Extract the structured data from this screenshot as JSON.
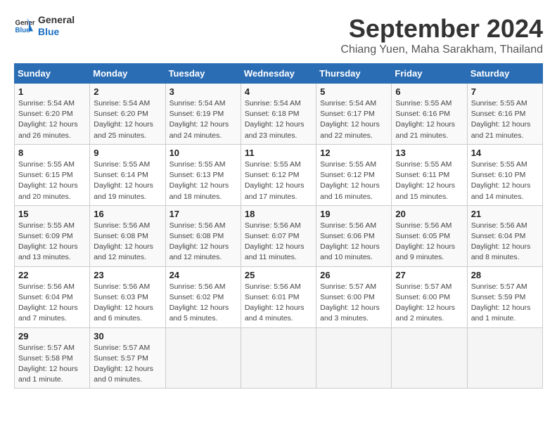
{
  "header": {
    "logo_line1": "General",
    "logo_line2": "Blue",
    "title": "September 2024",
    "subtitle": "Chiang Yuen, Maha Sarakham, Thailand"
  },
  "weekdays": [
    "Sunday",
    "Monday",
    "Tuesday",
    "Wednesday",
    "Thursday",
    "Friday",
    "Saturday"
  ],
  "weeks": [
    [
      {
        "day": "1",
        "detail": "Sunrise: 5:54 AM\nSunset: 6:20 PM\nDaylight: 12 hours\nand 26 minutes."
      },
      {
        "day": "2",
        "detail": "Sunrise: 5:54 AM\nSunset: 6:20 PM\nDaylight: 12 hours\nand 25 minutes."
      },
      {
        "day": "3",
        "detail": "Sunrise: 5:54 AM\nSunset: 6:19 PM\nDaylight: 12 hours\nand 24 minutes."
      },
      {
        "day": "4",
        "detail": "Sunrise: 5:54 AM\nSunset: 6:18 PM\nDaylight: 12 hours\nand 23 minutes."
      },
      {
        "day": "5",
        "detail": "Sunrise: 5:54 AM\nSunset: 6:17 PM\nDaylight: 12 hours\nand 22 minutes."
      },
      {
        "day": "6",
        "detail": "Sunrise: 5:55 AM\nSunset: 6:16 PM\nDaylight: 12 hours\nand 21 minutes."
      },
      {
        "day": "7",
        "detail": "Sunrise: 5:55 AM\nSunset: 6:16 PM\nDaylight: 12 hours\nand 21 minutes."
      }
    ],
    [
      {
        "day": "8",
        "detail": "Sunrise: 5:55 AM\nSunset: 6:15 PM\nDaylight: 12 hours\nand 20 minutes."
      },
      {
        "day": "9",
        "detail": "Sunrise: 5:55 AM\nSunset: 6:14 PM\nDaylight: 12 hours\nand 19 minutes."
      },
      {
        "day": "10",
        "detail": "Sunrise: 5:55 AM\nSunset: 6:13 PM\nDaylight: 12 hours\nand 18 minutes."
      },
      {
        "day": "11",
        "detail": "Sunrise: 5:55 AM\nSunset: 6:12 PM\nDaylight: 12 hours\nand 17 minutes."
      },
      {
        "day": "12",
        "detail": "Sunrise: 5:55 AM\nSunset: 6:12 PM\nDaylight: 12 hours\nand 16 minutes."
      },
      {
        "day": "13",
        "detail": "Sunrise: 5:55 AM\nSunset: 6:11 PM\nDaylight: 12 hours\nand 15 minutes."
      },
      {
        "day": "14",
        "detail": "Sunrise: 5:55 AM\nSunset: 6:10 PM\nDaylight: 12 hours\nand 14 minutes."
      }
    ],
    [
      {
        "day": "15",
        "detail": "Sunrise: 5:55 AM\nSunset: 6:09 PM\nDaylight: 12 hours\nand 13 minutes."
      },
      {
        "day": "16",
        "detail": "Sunrise: 5:56 AM\nSunset: 6:08 PM\nDaylight: 12 hours\nand 12 minutes."
      },
      {
        "day": "17",
        "detail": "Sunrise: 5:56 AM\nSunset: 6:08 PM\nDaylight: 12 hours\nand 12 minutes."
      },
      {
        "day": "18",
        "detail": "Sunrise: 5:56 AM\nSunset: 6:07 PM\nDaylight: 12 hours\nand 11 minutes."
      },
      {
        "day": "19",
        "detail": "Sunrise: 5:56 AM\nSunset: 6:06 PM\nDaylight: 12 hours\nand 10 minutes."
      },
      {
        "day": "20",
        "detail": "Sunrise: 5:56 AM\nSunset: 6:05 PM\nDaylight: 12 hours\nand 9 minutes."
      },
      {
        "day": "21",
        "detail": "Sunrise: 5:56 AM\nSunset: 6:04 PM\nDaylight: 12 hours\nand 8 minutes."
      }
    ],
    [
      {
        "day": "22",
        "detail": "Sunrise: 5:56 AM\nSunset: 6:04 PM\nDaylight: 12 hours\nand 7 minutes."
      },
      {
        "day": "23",
        "detail": "Sunrise: 5:56 AM\nSunset: 6:03 PM\nDaylight: 12 hours\nand 6 minutes."
      },
      {
        "day": "24",
        "detail": "Sunrise: 5:56 AM\nSunset: 6:02 PM\nDaylight: 12 hours\nand 5 minutes."
      },
      {
        "day": "25",
        "detail": "Sunrise: 5:56 AM\nSunset: 6:01 PM\nDaylight: 12 hours\nand 4 minutes."
      },
      {
        "day": "26",
        "detail": "Sunrise: 5:57 AM\nSunset: 6:00 PM\nDaylight: 12 hours\nand 3 minutes."
      },
      {
        "day": "27",
        "detail": "Sunrise: 5:57 AM\nSunset: 6:00 PM\nDaylight: 12 hours\nand 2 minutes."
      },
      {
        "day": "28",
        "detail": "Sunrise: 5:57 AM\nSunset: 5:59 PM\nDaylight: 12 hours\nand 1 minute."
      }
    ],
    [
      {
        "day": "29",
        "detail": "Sunrise: 5:57 AM\nSunset: 5:58 PM\nDaylight: 12 hours\nand 1 minute."
      },
      {
        "day": "30",
        "detail": "Sunrise: 5:57 AM\nSunset: 5:57 PM\nDaylight: 12 hours\nand 0 minutes."
      },
      {
        "day": "",
        "detail": ""
      },
      {
        "day": "",
        "detail": ""
      },
      {
        "day": "",
        "detail": ""
      },
      {
        "day": "",
        "detail": ""
      },
      {
        "day": "",
        "detail": ""
      }
    ]
  ]
}
